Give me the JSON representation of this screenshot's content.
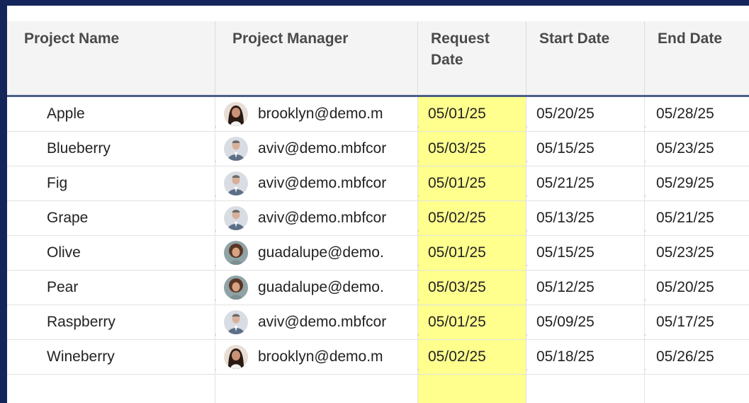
{
  "columns": [
    {
      "label": "Project Name"
    },
    {
      "label": "Project Manager"
    },
    {
      "label": "Request Date",
      "line1": "Request",
      "line2": "Date"
    },
    {
      "label": "Start Date"
    },
    {
      "label": "End Date"
    }
  ],
  "rows": [
    {
      "project": "Apple",
      "manager": "brooklyn@demo.m",
      "avatar": "woman-dark-hair-avatar",
      "request": "05/01/25",
      "start": "05/20/25",
      "end": "05/28/25"
    },
    {
      "project": "Blueberry",
      "manager": "aviv@demo.mbfcor",
      "avatar": "man-suit-avatar",
      "request": "05/03/25",
      "start": "05/15/25",
      "end": "05/23/25"
    },
    {
      "project": "Fig",
      "manager": "aviv@demo.mbfcor",
      "avatar": "man-suit-avatar",
      "request": "05/01/25",
      "start": "05/21/25",
      "end": "05/29/25"
    },
    {
      "project": "Grape",
      "manager": "aviv@demo.mbfcor",
      "avatar": "man-suit-avatar",
      "request": "05/02/25",
      "start": "05/13/25",
      "end": "05/21/25"
    },
    {
      "project": "Olive",
      "manager": "guadalupe@demo.",
      "avatar": "woman-curly-hair-avatar",
      "request": "05/01/25",
      "start": "05/15/25",
      "end": "05/23/25"
    },
    {
      "project": "Pear",
      "manager": "guadalupe@demo.",
      "avatar": "woman-curly-hair-avatar",
      "request": "05/03/25",
      "start": "05/12/25",
      "end": "05/20/25"
    },
    {
      "project": "Raspberry",
      "manager": "aviv@demo.mbfcor",
      "avatar": "man-suit-avatar",
      "request": "05/01/25",
      "start": "05/09/25",
      "end": "05/17/25"
    },
    {
      "project": "Wineberry",
      "manager": "brooklyn@demo.m",
      "avatar": "woman-dark-hair-avatar",
      "request": "05/02/25",
      "start": "05/18/25",
      "end": "05/26/25"
    }
  ],
  "colors": {
    "frame_border": "#14255c",
    "header_bg": "#f4f4f4",
    "header_rule": "#4a5f86",
    "highlight": "#ffff8e",
    "text": "#222222",
    "header_text": "#4a4a4a"
  }
}
